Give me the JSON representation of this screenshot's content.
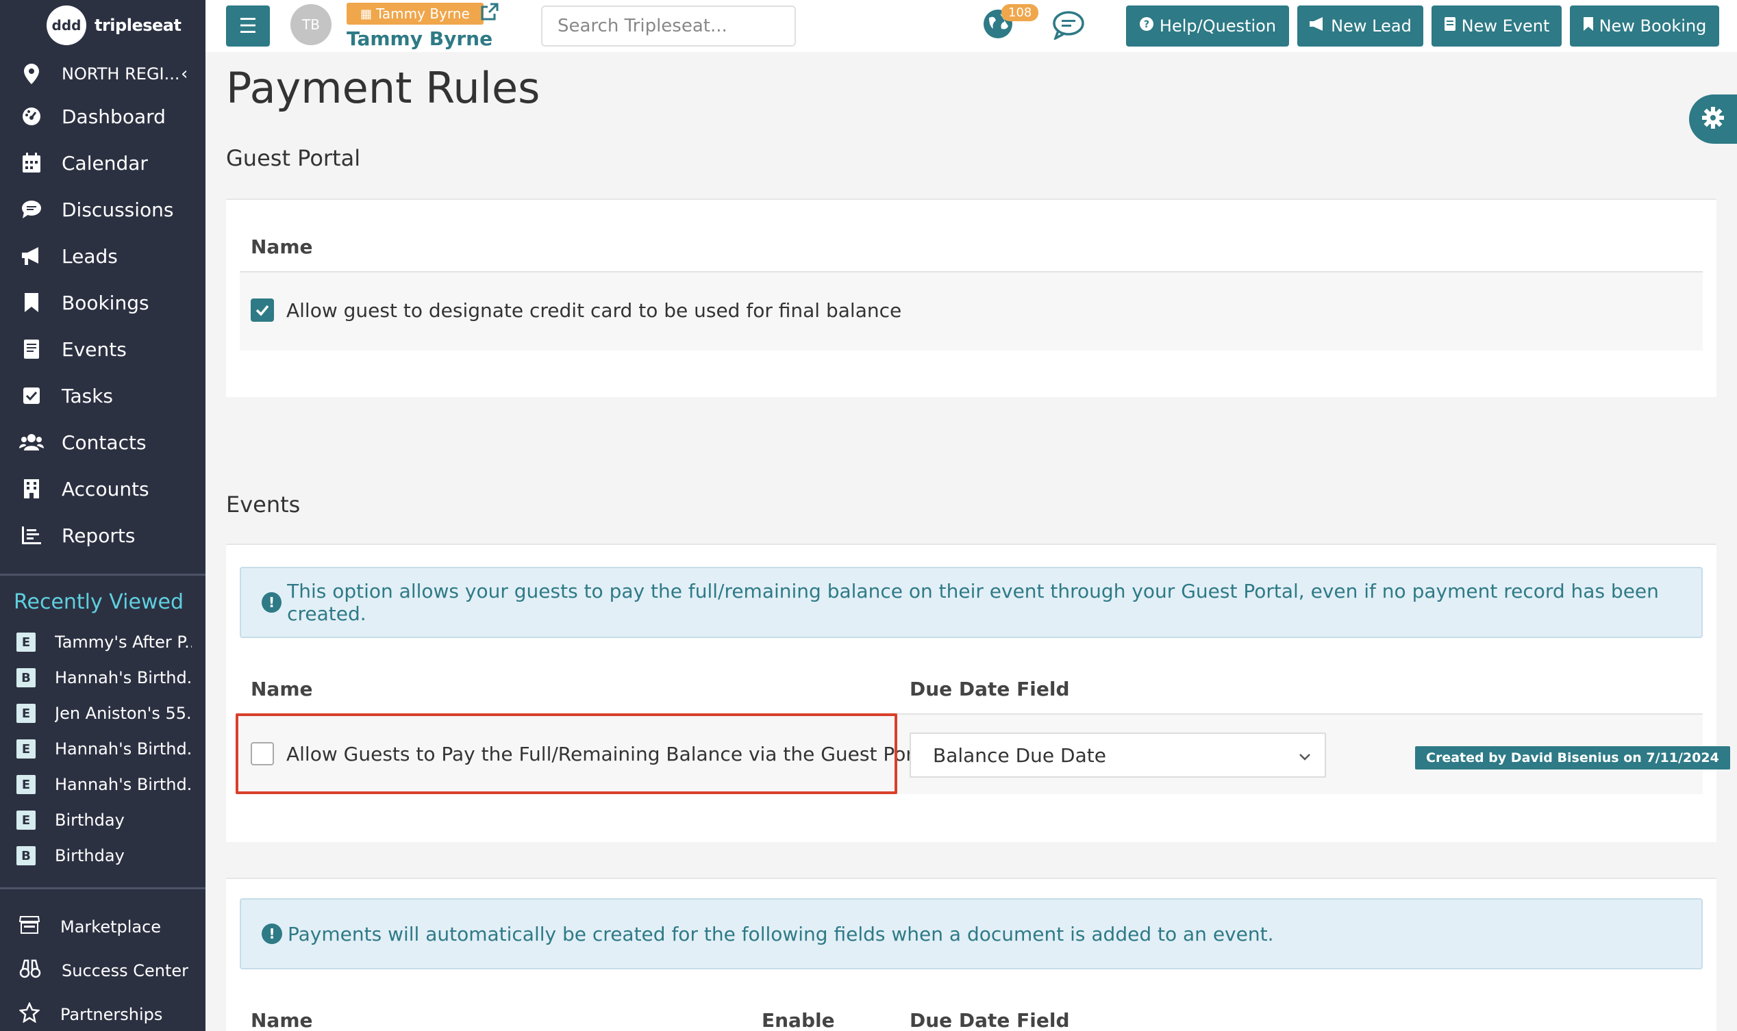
{
  "app": {
    "logo_text": "tripleseat",
    "logo_mark": "ddd"
  },
  "sidebar": {
    "region": "NORTH REGI...",
    "items": [
      {
        "label": "Dashboard",
        "icon": "dashboard-icon"
      },
      {
        "label": "Calendar",
        "icon": "calendar-icon"
      },
      {
        "label": "Discussions",
        "icon": "discussions-icon"
      },
      {
        "label": "Leads",
        "icon": "megaphone-icon"
      },
      {
        "label": "Bookings",
        "icon": "bookmark-icon"
      },
      {
        "label": "Events",
        "icon": "events-icon"
      },
      {
        "label": "Tasks",
        "icon": "tasks-icon"
      },
      {
        "label": "Contacts",
        "icon": "contacts-icon"
      },
      {
        "label": "Accounts",
        "icon": "building-icon"
      },
      {
        "label": "Reports",
        "icon": "reports-icon"
      }
    ],
    "recently_viewed_title": "Recently Viewed",
    "recent": [
      {
        "badge": "E",
        "label": "Tammy's After P..."
      },
      {
        "badge": "B",
        "label": "Hannah's Birthd..."
      },
      {
        "badge": "E",
        "label": "Jen Aniston's 55..."
      },
      {
        "badge": "E",
        "label": "Hannah's Birthd..."
      },
      {
        "badge": "E",
        "label": "Hannah's Birthd..."
      },
      {
        "badge": "E",
        "label": "Birthday"
      },
      {
        "badge": "B",
        "label": "Birthday"
      }
    ],
    "bottom": [
      {
        "label": "Marketplace",
        "icon": "store-icon"
      },
      {
        "label": "Success Center",
        "icon": "binoculars-icon"
      },
      {
        "label": "Partnerships",
        "icon": "star-icon"
      }
    ]
  },
  "topbar": {
    "avatar_initials": "TB",
    "user_tag": "Tammy Byrne",
    "user_name": "Tammy Byrne",
    "search_placeholder": "Search Tripleseat...",
    "notification_count": "108",
    "buttons": {
      "help": "Help/Question",
      "new_lead": "New Lead",
      "new_event": "New Event",
      "new_booking": "New Booking"
    }
  },
  "page": {
    "title": "Payment Rules",
    "guest_portal": {
      "title": "Guest Portal",
      "col_name": "Name",
      "option_label": "Allow guest to designate credit card to be used for final balance",
      "option_checked": true
    },
    "events": {
      "title": "Events",
      "info": "This option allows your guests to pay the full/remaining balance on their event through your Guest Portal, even if no payment record has been created.",
      "col_name": "Name",
      "col_due": "Due Date Field",
      "option_label": "Allow Guests to Pay the Full/Remaining Balance via the Guest Portal",
      "option_checked": false,
      "due_date_value": "Balance Due Date",
      "created_by": "Created by David Bisenius on 7/11/2024"
    },
    "documents": {
      "info": "Payments will automatically be created for the following fields when a document is added to an event.",
      "col_name": "Name",
      "col_enable": "Enable",
      "col_due": "Due Date Field"
    }
  },
  "colors": {
    "sidebar_bg": "#2c3142",
    "accent": "#2e7a86",
    "orange": "#f0a64b",
    "highlight": "#d9402b"
  }
}
